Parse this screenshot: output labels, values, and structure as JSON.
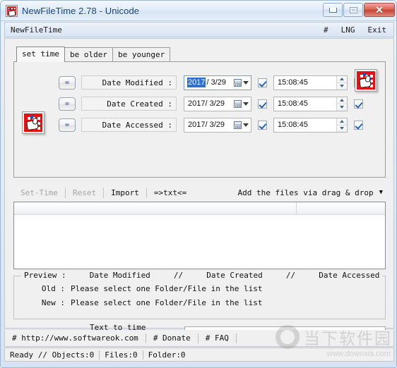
{
  "window": {
    "title": "NewFileTime 2.78 - Unicode",
    "icon": "calendar-clock-icon",
    "buttons": {
      "minimize": "minimize-icon",
      "maximize": "maximize-icon",
      "close": "✕"
    }
  },
  "menubar": {
    "app_name": "NewFileTime",
    "hash": "#",
    "lng": "LNG",
    "exit": "Exit"
  },
  "tabs": [
    {
      "label": "set time",
      "active": true
    },
    {
      "label": "be older",
      "active": false
    },
    {
      "label": "be younger",
      "active": false
    }
  ],
  "rows": [
    {
      "eq": "=",
      "label": "Date Modified :",
      "date_selected": "2017",
      "date_rest": "/ 3/29",
      "date_checkbox": true,
      "time": "15:08:45",
      "time_checkbox": true
    },
    {
      "eq": "=",
      "label": "Date Created :",
      "date_selected": "",
      "date_rest": "2017/ 3/29",
      "date_checkbox": true,
      "time": "15:08:45",
      "time_checkbox": true
    },
    {
      "eq": "=",
      "label": "Date Accessed :",
      "date_selected": "",
      "date_rest": "2017/ 3/29",
      "date_checkbox": true,
      "time": "15:08:45",
      "time_checkbox": true
    }
  ],
  "toolbar": {
    "set_time": "Set-Time",
    "set_time_enabled": false,
    "reset": "Reset",
    "reset_enabled": false,
    "import": "Import",
    "txt": "=>txt<=",
    "dropzone": "Add the files via drag & drop",
    "dropzone_caret": "▼"
  },
  "preview": {
    "legend": "Preview :     Date Modified     //     Date Created     //     Date Accessed",
    "old_key": "Old :",
    "old_value": "Please select one Folder/File in the list",
    "new_key": "New :",
    "new_value": "Please select one Folder/File in the list"
  },
  "tester": {
    "label": "Text to time tester",
    "value": "",
    "placeholder": ""
  },
  "footer": {
    "website": "# http://www.softwareok.com",
    "donate": "# Donate",
    "faq": "# FAQ"
  },
  "status": {
    "ready": "Ready // Objects:0",
    "files": "Files:0",
    "folder": "Folder:0"
  },
  "watermark": {
    "cn": "当下软件园",
    "url": "www.downxia.com"
  },
  "colors": {
    "title_text": "#12407a",
    "close_button": "#c34334",
    "selection": "#2f6fd0",
    "calendar_red": "#e81010",
    "calendar_blue": "#1a4fd0",
    "disabled_text": "#a4a4a4"
  }
}
